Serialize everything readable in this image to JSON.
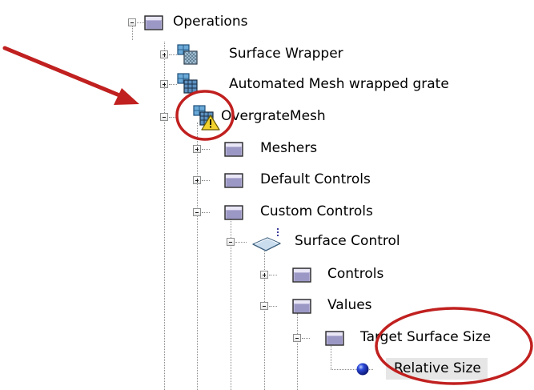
{
  "tree": {
    "nodes": [
      {
        "id": "operations",
        "label": "Operations",
        "expander": "minus",
        "icon": "folder-icon"
      },
      {
        "id": "surface-wrapper",
        "label": "Surface Wrapper",
        "expander": "plus",
        "icon": "surface-wrapper-icon"
      },
      {
        "id": "automated-mesh-wrapped-grate",
        "label": "Automated Mesh wrapped grate",
        "expander": "plus",
        "icon": "automated-mesh-icon"
      },
      {
        "id": "overgrate-mesh",
        "label": "OvergrateMesh",
        "expander": "minus",
        "icon": "automated-mesh-warning-icon"
      },
      {
        "id": "meshers",
        "label": "Meshers",
        "expander": "plus",
        "icon": "folder-icon"
      },
      {
        "id": "default-controls",
        "label": "Default Controls",
        "expander": "plus",
        "icon": "folder-icon"
      },
      {
        "id": "custom-controls",
        "label": "Custom Controls",
        "expander": "minus",
        "icon": "folder-icon"
      },
      {
        "id": "surface-control",
        "label": "Surface Control",
        "expander": "minus",
        "icon": "surface-control-icon"
      },
      {
        "id": "controls",
        "label": "Controls",
        "expander": "plus",
        "icon": "folder-icon"
      },
      {
        "id": "values",
        "label": "Values",
        "expander": "minus",
        "icon": "folder-icon"
      },
      {
        "id": "target-surface-size",
        "label": "Target Surface Size",
        "expander": "minus",
        "icon": "folder-icon"
      },
      {
        "id": "relative-size",
        "label": "Relative Size",
        "expander": "none",
        "icon": "blue-sphere-icon",
        "selected": true
      }
    ]
  },
  "annotations": {
    "color": "#c0201f"
  }
}
